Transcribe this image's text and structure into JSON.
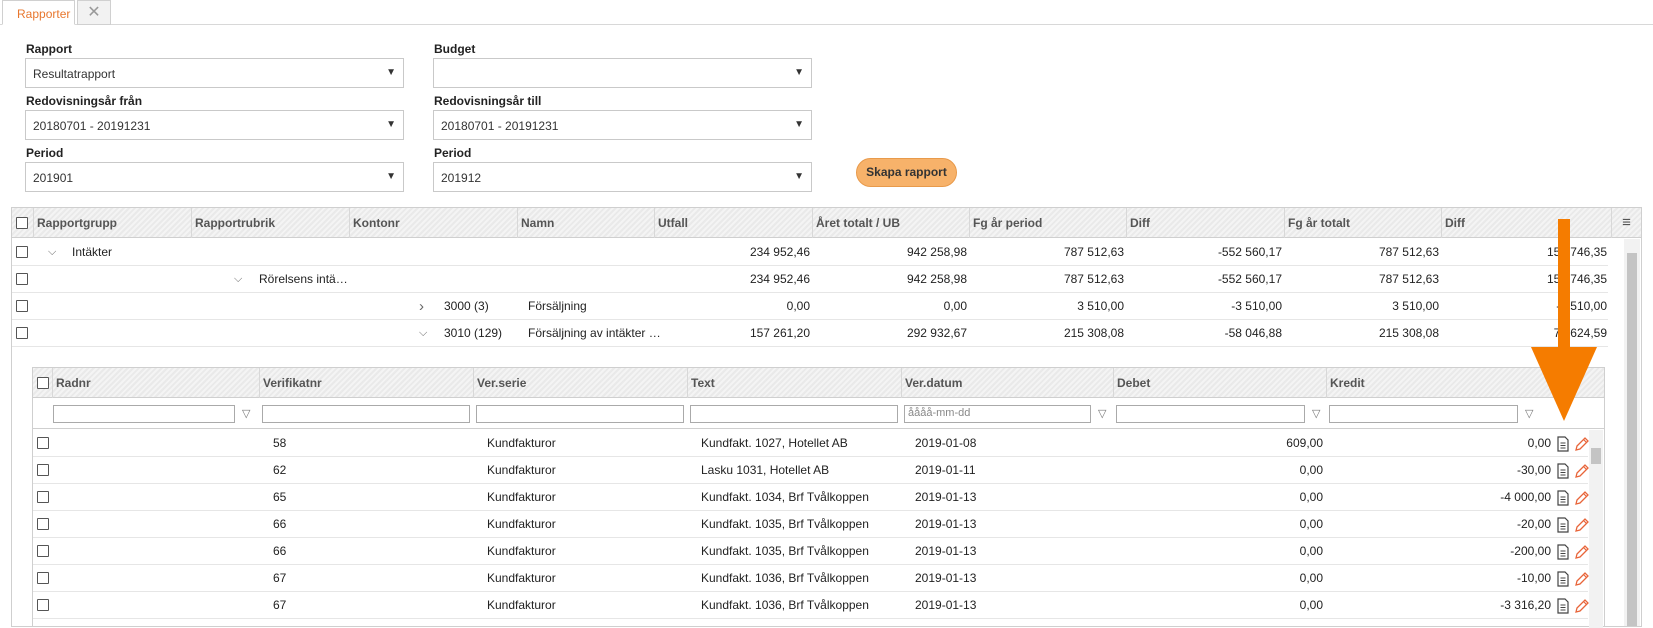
{
  "tabs": {
    "active_label": "Rapporter",
    "close_glyph": "✕"
  },
  "form": {
    "rapport": {
      "label": "Rapport",
      "value": "Resultatrapport"
    },
    "budget": {
      "label": "Budget",
      "value": ""
    },
    "year_from": {
      "label": "Redovisningsår från",
      "value": "20180701 - 20191231"
    },
    "year_to": {
      "label": "Redovisningsår till",
      "value": "20180701 - 20191231"
    },
    "period_from": {
      "label": "Period",
      "value": "201901"
    },
    "period_to": {
      "label": "Period",
      "value": "201912"
    },
    "create_button": "Skapa rapport",
    "caret": "▼"
  },
  "report_grid": {
    "columns": [
      "Rapportgrupp",
      "Rapportrubrik",
      "Kontonr",
      "Namn",
      "Utfall",
      "Året totalt / UB",
      "Fg år period",
      "Diff",
      "Fg år totalt",
      "Diff"
    ],
    "menu_icon": "≡",
    "rows": [
      {
        "group": "Intäkter",
        "rubrik": "",
        "kontonr": "",
        "namn": "",
        "utfall": "234 952,46",
        "aret": "942 258,98",
        "fg_period": "787 512,63",
        "diff1": "-552 560,17",
        "fg_totalt": "787 512,63",
        "diff2": "154 746,35",
        "chev": "⌵"
      },
      {
        "group": "",
        "rubrik": "Rörelsens intä…",
        "kontonr": "",
        "namn": "",
        "utfall": "234 952,46",
        "aret": "942 258,98",
        "fg_period": "787 512,63",
        "diff1": "-552 560,17",
        "fg_totalt": "787 512,63",
        "diff2": "154 746,35",
        "chev": "⌵"
      },
      {
        "group": "",
        "rubrik": "",
        "kontonr": "3000 (3)",
        "namn": "Försäljning",
        "utfall": "0,00",
        "aret": "0,00",
        "fg_period": "3 510,00",
        "diff1": "-3 510,00",
        "fg_totalt": "3 510,00",
        "diff2": "-3 510,00",
        "chev": "›"
      },
      {
        "group": "",
        "rubrik": "",
        "kontonr": "3010 (129)",
        "namn": "Försäljning av intäkter …",
        "utfall": "157 261,20",
        "aret": "292 932,67",
        "fg_period": "215 308,08",
        "diff1": "-58 046,88",
        "fg_totalt": "215 308,08",
        "diff2": "77 624,59",
        "chev": "⌵"
      }
    ]
  },
  "detail_grid": {
    "columns": [
      "Radnr",
      "Verifikatnr",
      "Ver.serie",
      "Text",
      "Ver.datum",
      "Debet",
      "Kredit"
    ],
    "date_placeholder": "åååå-mm-dd",
    "funnel_glyph": "▽",
    "rows": [
      {
        "radnr": "",
        "verifikatnr": "58",
        "serie": "Kundfakturor",
        "text": "Kundfakt. 1027, Hotellet AB",
        "datum": "2019-01-08",
        "debet": "609,00",
        "kredit": "0,00"
      },
      {
        "radnr": "",
        "verifikatnr": "62",
        "serie": "Kundfakturor",
        "text": "Lasku 1031, Hotellet AB",
        "datum": "2019-01-11",
        "debet": "0,00",
        "kredit": "-30,00"
      },
      {
        "radnr": "",
        "verifikatnr": "65",
        "serie": "Kundfakturor",
        "text": "Kundfakt. 1034, Brf Tvålkoppen",
        "datum": "2019-01-13",
        "debet": "0,00",
        "kredit": "-4 000,00"
      },
      {
        "radnr": "",
        "verifikatnr": "66",
        "serie": "Kundfakturor",
        "text": "Kundfakt. 1035, Brf Tvålkoppen",
        "datum": "2019-01-13",
        "debet": "0,00",
        "kredit": "-20,00"
      },
      {
        "radnr": "",
        "verifikatnr": "66",
        "serie": "Kundfakturor",
        "text": "Kundfakt. 1035, Brf Tvålkoppen",
        "datum": "2019-01-13",
        "debet": "0,00",
        "kredit": "-200,00"
      },
      {
        "radnr": "",
        "verifikatnr": "67",
        "serie": "Kundfakturor",
        "text": "Kundfakt. 1036, Brf Tvålkoppen",
        "datum": "2019-01-13",
        "debet": "0,00",
        "kredit": "-10,00"
      },
      {
        "radnr": "",
        "verifikatnr": "67",
        "serie": "Kundfakturor",
        "text": "Kundfakt. 1036, Brf Tvålkoppen",
        "datum": "2019-01-13",
        "debet": "0,00",
        "kredit": "-3 316,20"
      }
    ]
  },
  "icons": {
    "row_actions": [
      "document-icon",
      "edit-pencil-icon"
    ],
    "annotation": "arrow-down-icon"
  },
  "colors": {
    "accent": "#e8772e",
    "button": "#f7b26a",
    "arrow": "#f57c00"
  }
}
